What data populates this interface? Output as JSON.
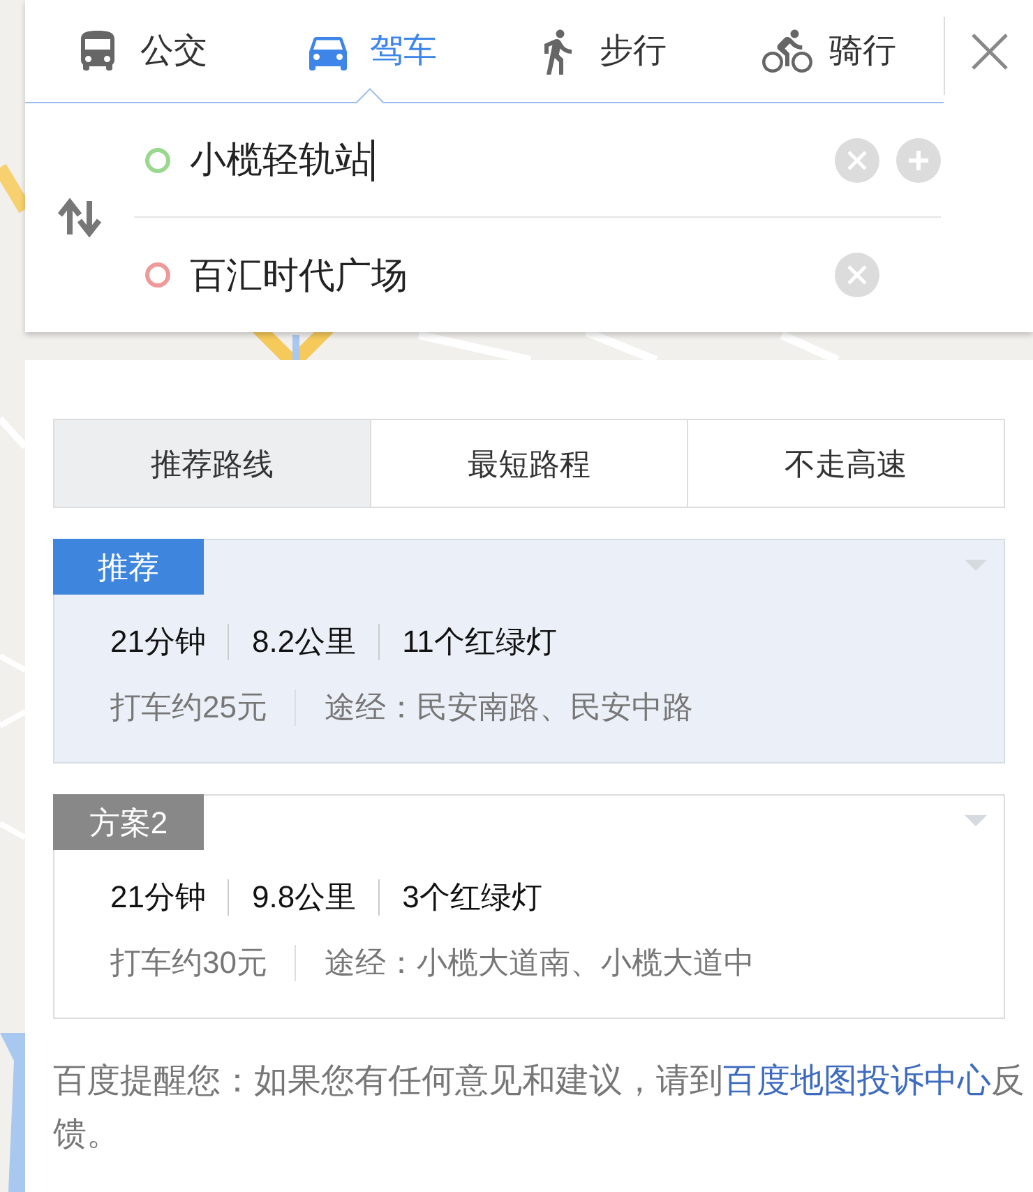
{
  "modes": [
    {
      "kind": "bus",
      "label": "公交",
      "selected": false
    },
    {
      "kind": "car",
      "label": "驾车",
      "selected": true
    },
    {
      "kind": "walk",
      "label": "步行",
      "selected": false
    },
    {
      "kind": "bike",
      "label": "骑行",
      "selected": false
    }
  ],
  "inputs": [
    {
      "value": "小榄轻轨站",
      "color": "#9bd88f",
      "focused": true,
      "addable": true
    },
    {
      "value": "百汇时代广场",
      "color": "#ef9a9a",
      "focused": false,
      "addable": false
    }
  ],
  "route_options": [
    {
      "label": "推荐路线",
      "selected": true
    },
    {
      "label": "最短路程",
      "selected": false
    },
    {
      "label": "不走高速",
      "selected": false
    }
  ],
  "routes": [
    {
      "badge": "推荐",
      "selected": true,
      "time": "21分钟",
      "distance": "8.2公里",
      "lights": "11个红绿灯",
      "taxi": "打车约25元",
      "via": "途经：民安南路、民安中路"
    },
    {
      "badge": "方案2",
      "selected": false,
      "time": "21分钟",
      "distance": "9.8公里",
      "lights": "3个红绿灯",
      "taxi": "打车约30元",
      "via": "途经：小榄大道南、小榄大道中"
    }
  ],
  "notice": {
    "text": "百度提醒您：如果您有任何意见和建议，请到",
    "link": "百度地图投诉中心",
    "suffix": "反馈。"
  }
}
